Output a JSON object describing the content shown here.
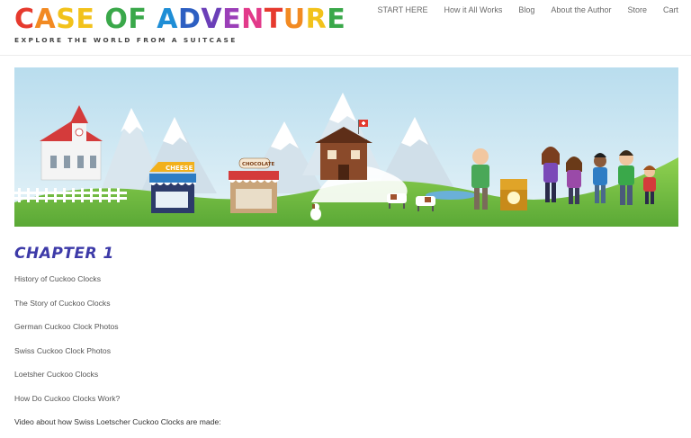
{
  "header": {
    "logo_title": "CASE OF ADVENTURE",
    "logo_tagline": "EXPLORE THE WORLD FROM A SUITCASE",
    "logo_letter_colors": [
      "#e63a2e",
      "#f28a22",
      "#f2c21b",
      "#f2c21b",
      "#3aa84a",
      "#3aa84a",
      "#1f8ed6",
      "#2d5fc2",
      "#6b3fb8",
      "#9b3fb8",
      "#e23a8a",
      "#e63a2e",
      "#f28a22",
      "#f2c21b",
      "#3aa84a",
      "#1f8ed6",
      "#6b3fb8"
    ]
  },
  "nav": {
    "items": [
      {
        "label": "START HERE"
      },
      {
        "label": "How it All Works"
      },
      {
        "label": "Blog"
      },
      {
        "label": "About the Author"
      },
      {
        "label": "Store"
      },
      {
        "label": "Cart"
      }
    ]
  },
  "banner": {
    "sign_cheese": "CHEESE",
    "sign_chocolate": "CHOCOLATE"
  },
  "main": {
    "heading": "CHAPTER 1",
    "links": [
      {
        "label": "History of Cuckoo Clocks"
      },
      {
        "label": "The Story of Cuckoo Clocks"
      },
      {
        "label": "German Cuckoo Clock Photos"
      },
      {
        "label": "Swiss Cuckoo Clock Photos"
      },
      {
        "label": "Loetsher Cuckoo Clocks"
      },
      {
        "label": "How Do Cuckoo Clocks Work?"
      }
    ],
    "video_text": "Video about how Swiss Loetscher Cuckoo Clocks are made:"
  },
  "colors": {
    "heading": "#3d3aa8",
    "sky": "#cfe8f4",
    "grass": "#7cc24a"
  }
}
